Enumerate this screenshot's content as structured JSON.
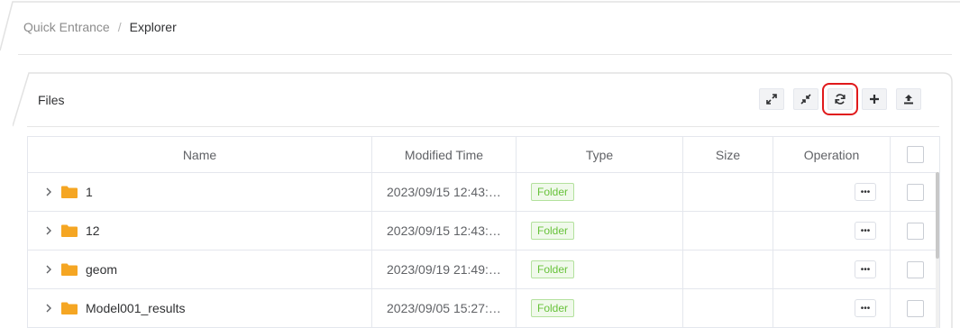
{
  "breadcrumb": {
    "items": [
      "Quick Entrance",
      "Explorer"
    ],
    "separator": "/"
  },
  "panel": {
    "title": "Files"
  },
  "toolbar": {
    "buttons": [
      {
        "icon": "expand-icon"
      },
      {
        "icon": "collapse-icon"
      },
      {
        "icon": "refresh-icon",
        "highlighted": true
      },
      {
        "icon": "plus-icon"
      },
      {
        "icon": "upload-icon"
      }
    ]
  },
  "table": {
    "columns": [
      "Name",
      "Modified Time",
      "Type",
      "Size",
      "Operation"
    ],
    "rows": [
      {
        "name": "1",
        "modified": "2023/09/15 12:43:…",
        "type": "Folder",
        "size": ""
      },
      {
        "name": "12",
        "modified": "2023/09/15 12:43:…",
        "type": "Folder",
        "size": ""
      },
      {
        "name": "geom",
        "modified": "2023/09/19 21:49:…",
        "type": "Folder",
        "size": ""
      },
      {
        "name": "Model001_results",
        "modified": "2023/09/05 15:27:…",
        "type": "Folder",
        "size": ""
      }
    ],
    "more_label": "•••"
  },
  "colors": {
    "folder": "#f5a623",
    "tag_text": "#67c23a",
    "highlight": "#e0191b"
  }
}
